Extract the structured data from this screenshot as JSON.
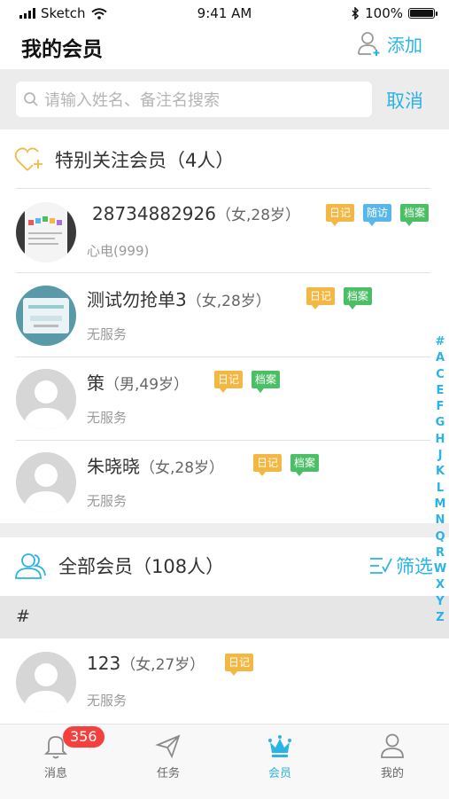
{
  "status_bar": {
    "carrier": "Sketch",
    "time": "9:41 AM",
    "battery": "100%"
  },
  "header": {
    "title": "我的会员",
    "add_label": "添加"
  },
  "search": {
    "placeholder": "请输入姓名、备注名搜索",
    "cancel_label": "取消"
  },
  "special": {
    "label": "特别关注会员（4人）",
    "members": [
      {
        "name": "28734882926",
        "meta": "（女,28岁）",
        "sub": "心电(999)",
        "tags": [
          "日记",
          "随访",
          "档案"
        ]
      },
      {
        "name": "测试勿抢单3",
        "meta": "（女,28岁）",
        "sub": "无服务",
        "tags": [
          "日记",
          "档案"
        ]
      },
      {
        "name": "策",
        "meta": "（男,49岁）",
        "sub": "无服务",
        "tags": [
          "日记",
          "档案"
        ]
      },
      {
        "name": "朱晓晓",
        "meta": "（女,28岁）",
        "sub": "无服务",
        "tags": [
          "日记",
          "档案"
        ]
      }
    ]
  },
  "all": {
    "label": "全部会员（108人）",
    "filter_label": "筛选",
    "group": "#",
    "members": [
      {
        "name": "123",
        "meta": "（女,27岁）",
        "sub": "无服务",
        "tags": [
          "日记"
        ]
      }
    ]
  },
  "index_letters": [
    "#",
    "A",
    "C",
    "E",
    "F",
    "G",
    "H",
    "J",
    "K",
    "L",
    "M",
    "N",
    "Q",
    "R",
    "W",
    "X",
    "Y",
    "Z"
  ],
  "tabbar": {
    "tabs": [
      {
        "label": "消息",
        "icon": "bell-icon"
      },
      {
        "label": "任务",
        "icon": "paper-plane-icon"
      },
      {
        "label": "会员",
        "icon": "crown-icon"
      },
      {
        "label": "我的",
        "icon": "person-icon"
      }
    ],
    "badge": "356",
    "active_color": "#2ab3e6"
  },
  "colors": {
    "accent": "#2ab3e6",
    "tag_diary": "#f3b843",
    "tag_followup": "#57b7ea",
    "tag_file": "#4bbf65",
    "badge": "#f4403f"
  }
}
